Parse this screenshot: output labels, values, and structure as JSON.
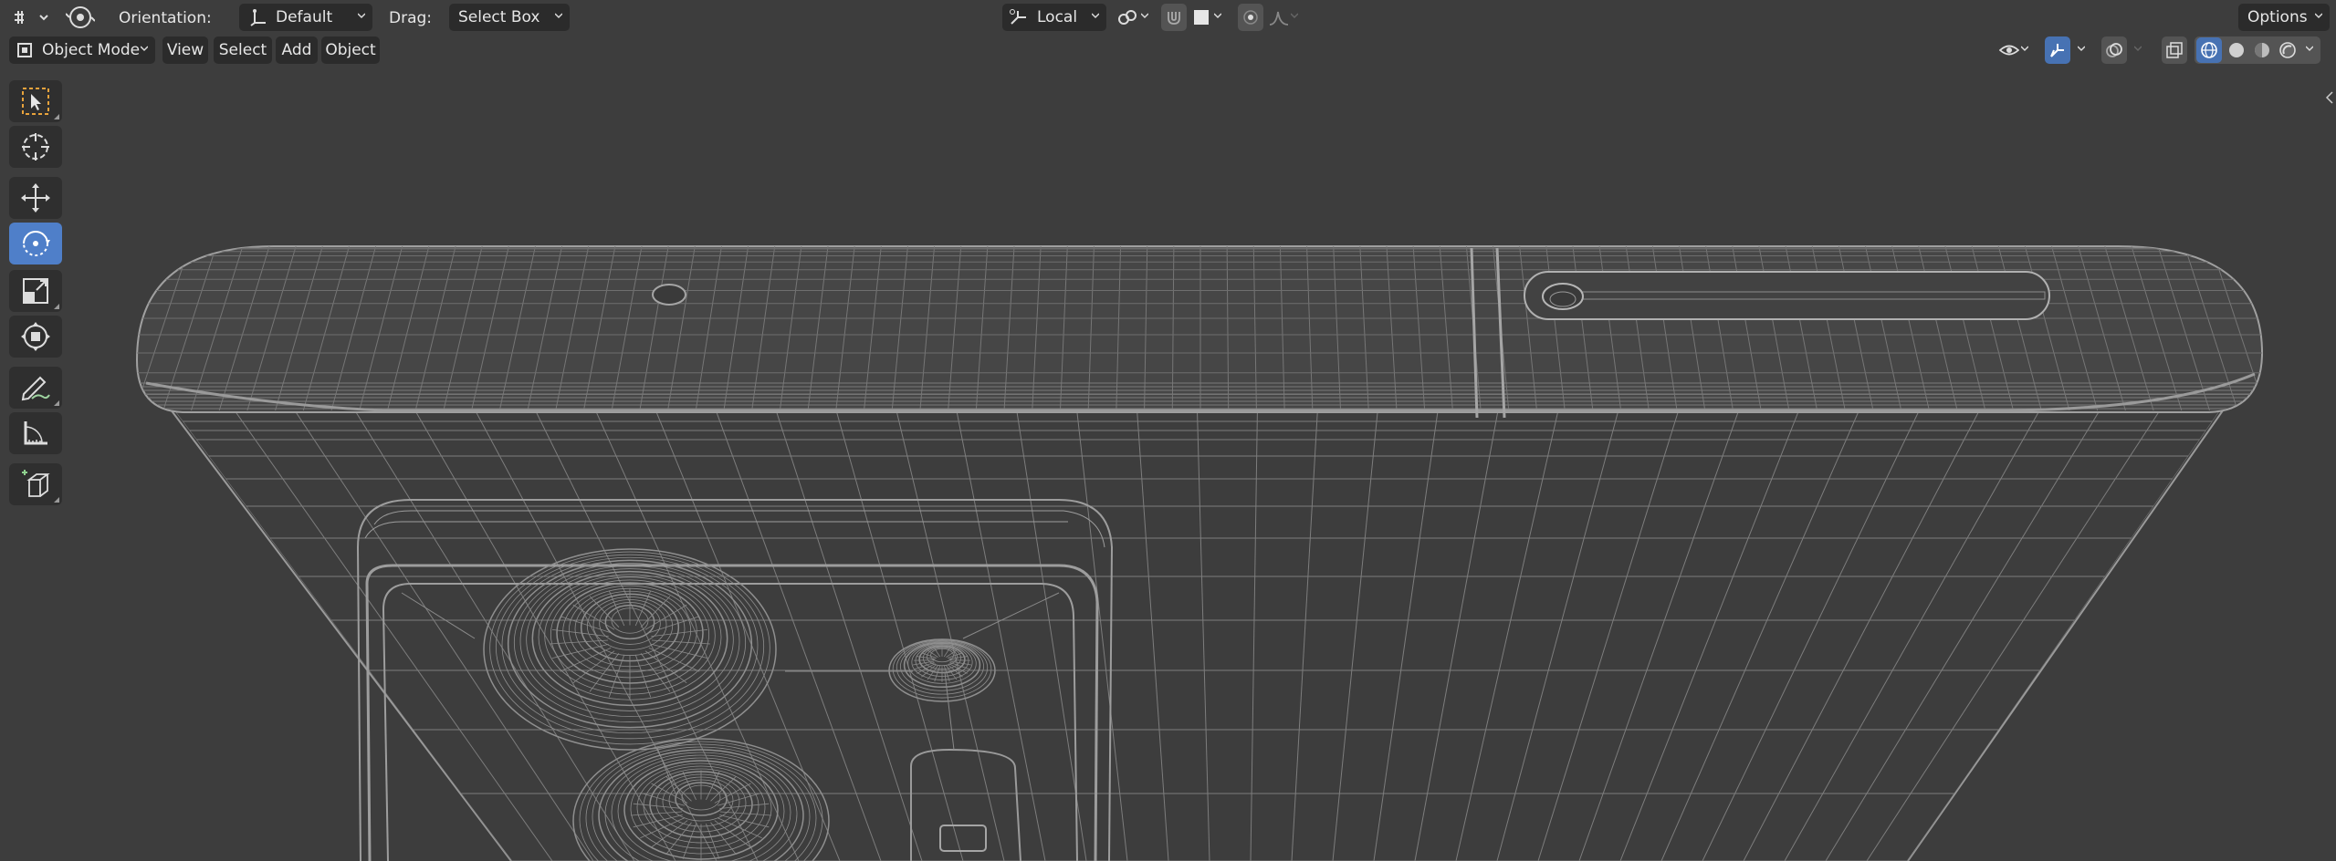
{
  "header": {
    "orientation_label": "Orientation:",
    "orientation_value": "Default",
    "drag_label": "Drag:",
    "drag_value": "Select Box",
    "pivot_value": "Local",
    "options_label": "Options"
  },
  "menubar": {
    "mode": "Object Mode",
    "menus": [
      "View",
      "Select",
      "Add",
      "Object"
    ]
  },
  "toolbar": {
    "tools": [
      "select-box",
      "cursor",
      "move",
      "rotate",
      "scale",
      "transform",
      "annotate",
      "measure",
      "add-cube"
    ],
    "active_tool": "rotate"
  },
  "colors": {
    "accent": "#4772b3",
    "viewport_bg": "#3d3d3d",
    "wire": "#8c8c8c"
  }
}
